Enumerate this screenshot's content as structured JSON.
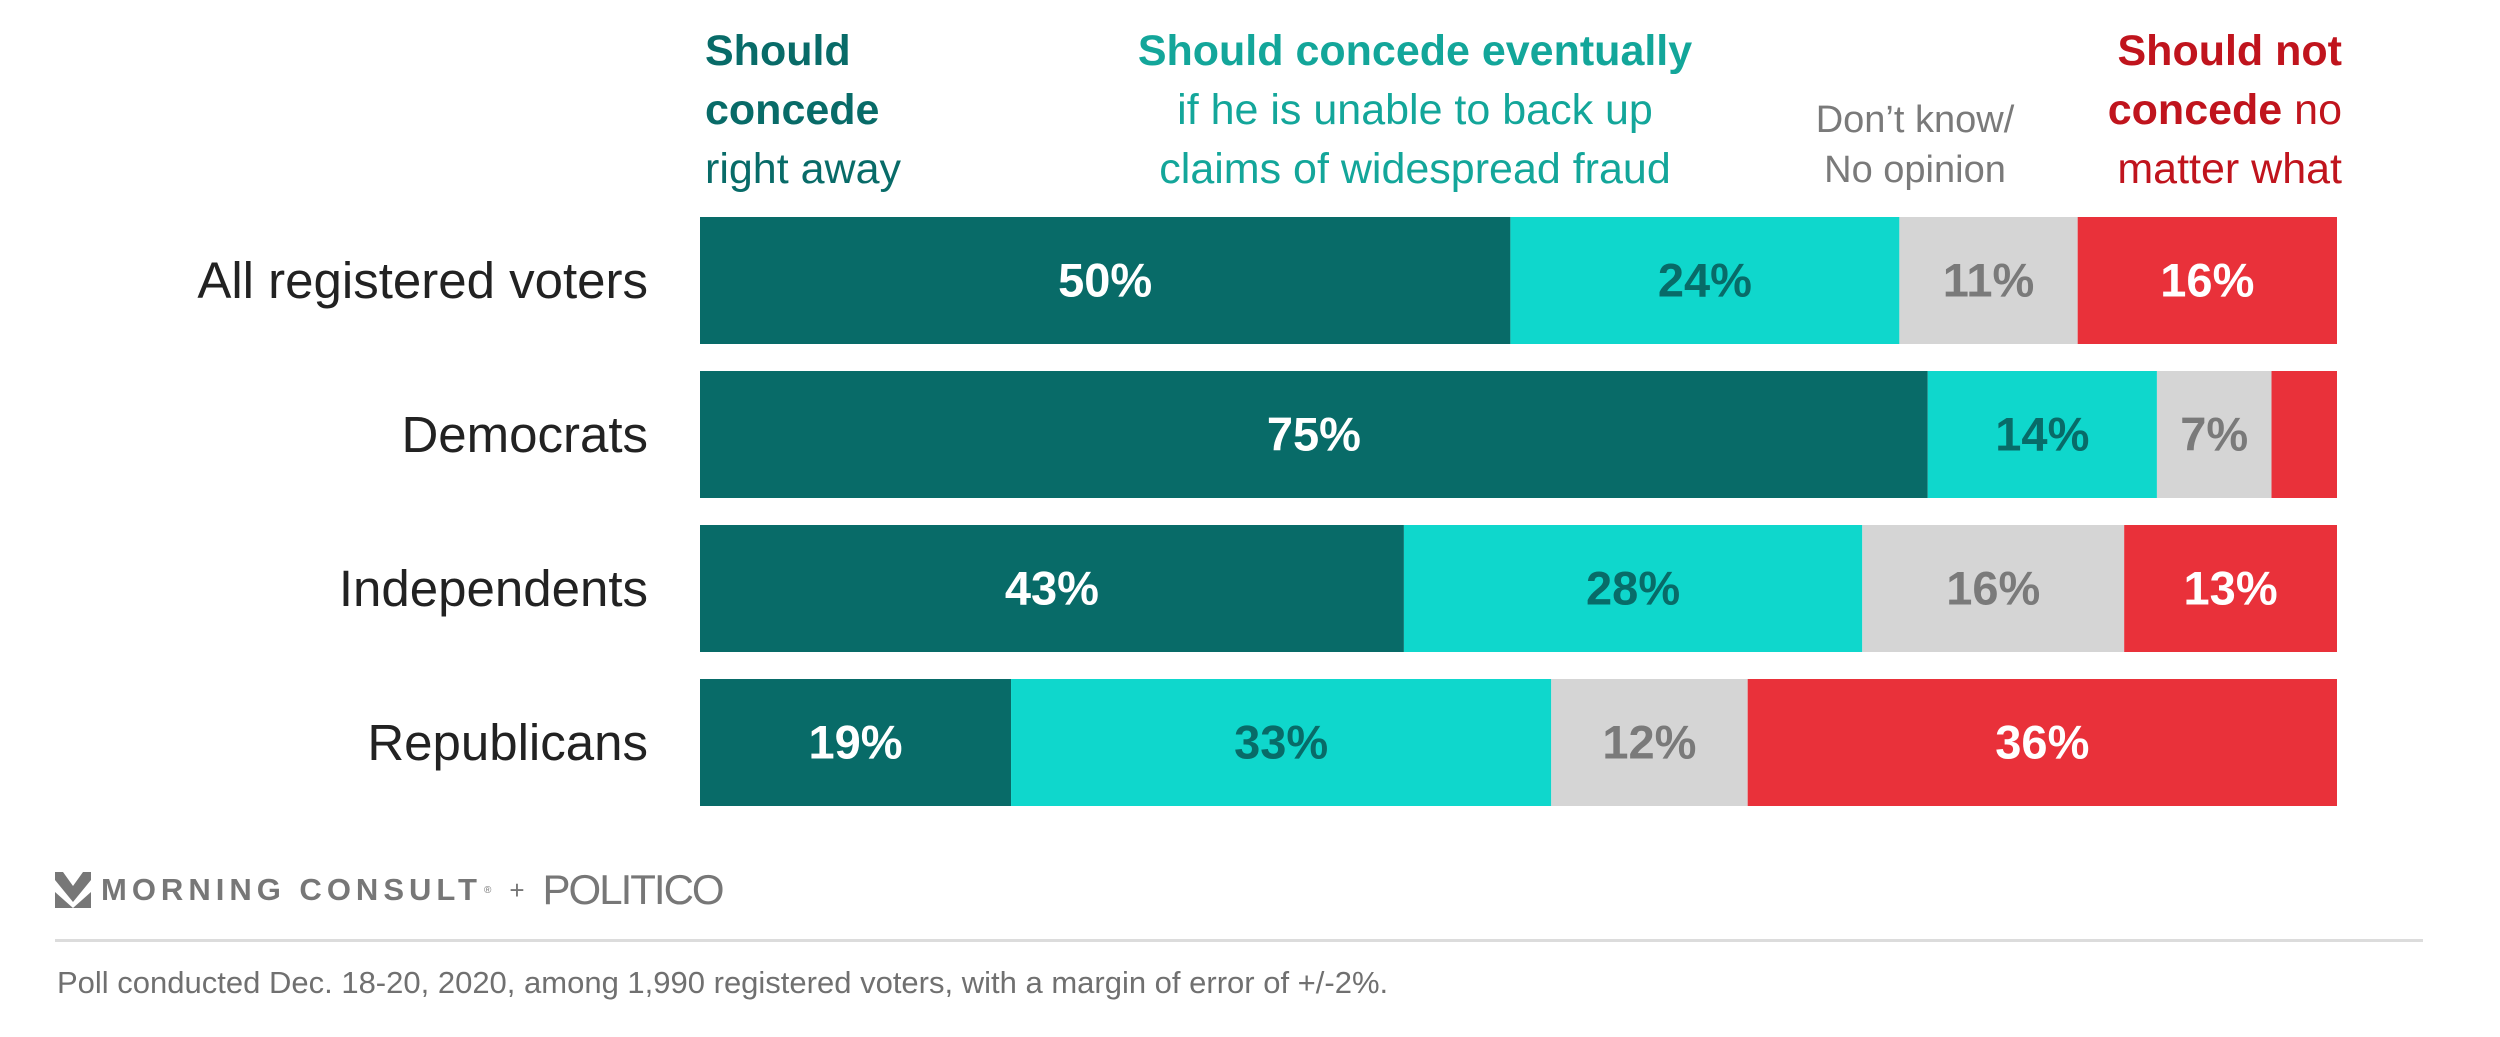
{
  "chart_data": {
    "type": "bar",
    "orientation": "horizontal",
    "stacked": true,
    "categories": [
      "All registered voters",
      "Democrats",
      "Independents",
      "Republicans"
    ],
    "series": [
      {
        "name": "Should concede right away",
        "color": "#086b68",
        "label_color": "#ffffff",
        "values": [
          50,
          75,
          43,
          19
        ],
        "labels": [
          "50%",
          "75%",
          "43%",
          "19%"
        ]
      },
      {
        "name": "Should concede eventually if he is unable to back up claims of widespread fraud",
        "color": "#0fd7cc",
        "label_color": "#086b68",
        "values": [
          24,
          14,
          28,
          33
        ],
        "labels": [
          "24%",
          "14%",
          "28%",
          "33%"
        ]
      },
      {
        "name": "Don't know/ No opinion",
        "color": "#d5d5d5",
        "label_color": "#7a7a7a",
        "values": [
          11,
          7,
          16,
          12
        ],
        "labels": [
          "11%",
          "7%",
          "16%",
          "12%"
        ]
      },
      {
        "name": "Should not concede no matter what",
        "color": "#e9313a",
        "label_color": "#ffffff",
        "values": [
          16,
          4,
          13,
          36
        ],
        "labels": [
          "16%",
          "",
          "13%",
          "36%"
        ]
      }
    ],
    "xlim": [
      0,
      101
    ],
    "grid": false,
    "legend": "top"
  },
  "headers": {
    "h0": {
      "bold1": "Should",
      "bold2": "concede",
      "rest": "right away"
    },
    "h1": {
      "bold": "Should concede eventually",
      "line2": "if he is unable to back up",
      "line3": "claims of widespread fraud"
    },
    "h2": {
      "line1": "Don’t know/",
      "line2": "No opinion"
    },
    "h3": {
      "bold1": "Should not",
      "bold2": "concede",
      "rest2": " no",
      "line3": "matter what"
    }
  },
  "branding": {
    "left": "MORNING CONSULT",
    "registered": "®",
    "plus": "+",
    "right": "POLITICO"
  },
  "footnote": "Poll conducted Dec. 18-20, 2020, among 1,990 registered voters, with a margin of error of +/-2%."
}
